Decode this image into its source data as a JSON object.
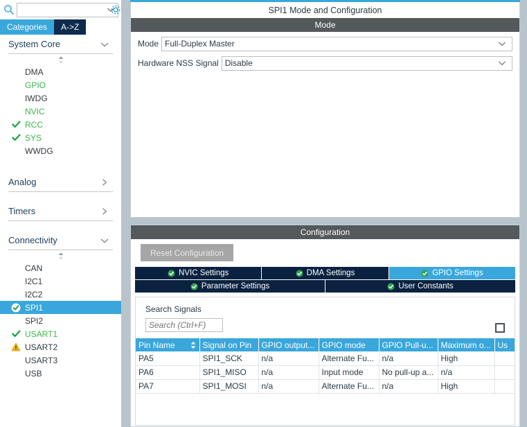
{
  "sidebar": {
    "search": {
      "value": "",
      "placeholder": "",
      "icon": "search-icon"
    },
    "gear_icon": "gear-icon",
    "tabs": [
      {
        "label": "Categories",
        "active": true
      },
      {
        "label": "A->Z",
        "active": false
      }
    ],
    "sections": [
      {
        "title": "System Core",
        "expanded": true,
        "items": [
          {
            "label": "DMA",
            "state": "none",
            "selected": false
          },
          {
            "label": "GPIO",
            "state": "green",
            "selected": false
          },
          {
            "label": "IWDG",
            "state": "none",
            "selected": false
          },
          {
            "label": "NVIC",
            "state": "green",
            "selected": false
          },
          {
            "label": "RCC",
            "state": "check",
            "selected": false
          },
          {
            "label": "SYS",
            "state": "check",
            "selected": false
          },
          {
            "label": "WWDG",
            "state": "none",
            "selected": false
          }
        ]
      },
      {
        "title": "Analog",
        "expanded": false,
        "items": []
      },
      {
        "title": "Timers",
        "expanded": false,
        "items": []
      },
      {
        "title": "Connectivity",
        "expanded": true,
        "items": [
          {
            "label": "CAN",
            "state": "none",
            "selected": false
          },
          {
            "label": "I2C1",
            "state": "none",
            "selected": false
          },
          {
            "label": "I2C2",
            "state": "none",
            "selected": false
          },
          {
            "label": "SPI1",
            "state": "selected",
            "selected": true
          },
          {
            "label": "SPI2",
            "state": "none",
            "selected": false
          },
          {
            "label": "USART1",
            "state": "check",
            "selected": false
          },
          {
            "label": "USART2",
            "state": "warning",
            "selected": false
          },
          {
            "label": "USART3",
            "state": "none",
            "selected": false
          },
          {
            "label": "USB",
            "state": "none",
            "selected": false
          }
        ]
      }
    ]
  },
  "mode_panel": {
    "title": "SPI1 Mode and Configuration",
    "section_label": "Mode",
    "fields": [
      {
        "label": "Mode",
        "value": "Full-Duplex Master"
      },
      {
        "label": "Hardware NSS Signal",
        "value": "Disable"
      }
    ]
  },
  "config_panel": {
    "section_label": "Configuration",
    "reset_button": "Reset Configuration",
    "tabs_row1": [
      {
        "label": "NVIC Settings",
        "active": false
      },
      {
        "label": "DMA Settings",
        "active": false
      },
      {
        "label": "GPIO Settings",
        "active": true
      }
    ],
    "tabs_row2": [
      {
        "label": "Parameter Settings",
        "active": false
      },
      {
        "label": "User Constants",
        "active": false
      }
    ],
    "signals": {
      "title": "Search Signals",
      "search_value": "",
      "search_placeholder": "Search (Ctrl+F)",
      "show_only_modified_checked": false,
      "columns": [
        "Pin Name",
        "Signal on Pin",
        "GPIO output...",
        "GPIO mode",
        "GPIO Pull-u...",
        "Maximum o...",
        "Us"
      ],
      "sorted_column": "Pin Name",
      "rows": [
        [
          "PA5",
          "SPI1_SCK",
          "n/a",
          "Alternate Fu...",
          "n/a",
          "High",
          ""
        ],
        [
          "PA6",
          "SPI1_MISO",
          "n/a",
          "Input mode",
          "No pull-up a...",
          "n/a",
          ""
        ],
        [
          "PA7",
          "SPI1_MOSI",
          "n/a",
          "Alternate Fu...",
          "n/a",
          "High",
          ""
        ]
      ]
    }
  },
  "colors": {
    "accent_blue": "#3aa7dc",
    "dark_navy": "#0a2240",
    "section_gray": "#54595c",
    "green": "#3ab54a",
    "warning_amber": "#f0ad1e",
    "panel_bg": "#b7c4cc"
  }
}
